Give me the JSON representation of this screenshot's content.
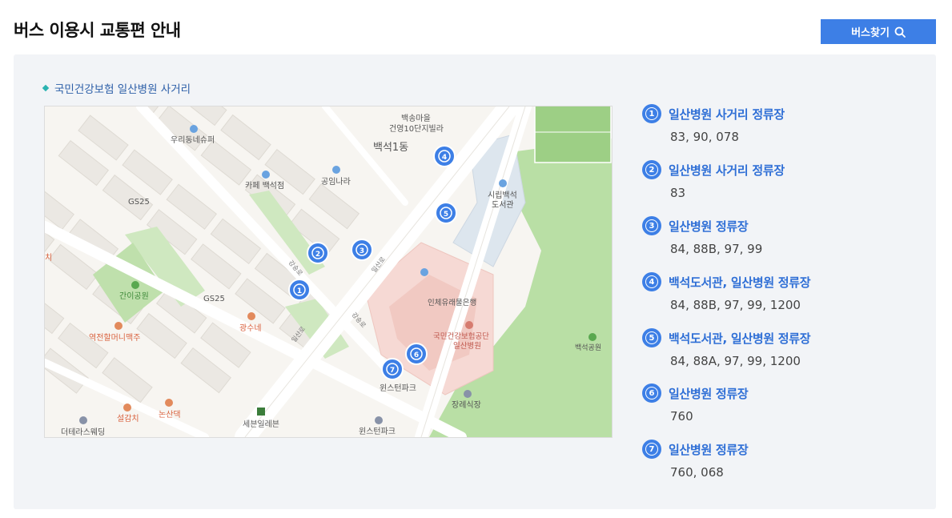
{
  "header": {
    "title": "버스 이용시 교통편 안내",
    "find_button_label": "버스찾기"
  },
  "location": {
    "name": "국민건강보험 일산병원 사거리"
  },
  "map": {
    "labels": {
      "baekma": "백송마을",
      "geonyoung": "건영10단지빌라",
      "baekseok1dong": "백석1동",
      "woori": "우리동네슈퍼",
      "cafe": "카페 백석점",
      "gongim": "공임나라",
      "library": "시립백석",
      "library2": "도서관",
      "gs25a": "GS25",
      "gs25b": "GS25",
      "ganipark": "간이공원",
      "bank": "인체유래물은행",
      "nhis1": "국민건강보험공단",
      "nhis2": "일산병원",
      "baekseokpark": "백석공원",
      "yeokjeon": "역전할머니맥주",
      "gwangsu": "광수네",
      "winston": "윈스턴파크",
      "winston2": "윈스턴파크",
      "funeral": "장례식장",
      "seolgam": "설감치",
      "nonsan": "논산댁",
      "seven": "세븐일레븐",
      "wedding": "더테라스웨딩",
      "chi": "치",
      "road1": "강송로",
      "road2": "일산로",
      "road3": "강송로",
      "road4": "일산로"
    },
    "markers": [
      "1",
      "2",
      "3",
      "4",
      "5",
      "6",
      "7"
    ]
  },
  "stops": [
    {
      "num": "1",
      "name": "일산병원 사거리 정류장",
      "routes": "83, 90, 078"
    },
    {
      "num": "2",
      "name": "일산병원 사거리 정류장",
      "routes": "83"
    },
    {
      "num": "3",
      "name": "일산병원 정류장",
      "routes": "84, 88B, 97, 99"
    },
    {
      "num": "4",
      "name": "백석도서관, 일산병원 정류장",
      "routes": "84, 88B, 97, 99, 1200"
    },
    {
      "num": "5",
      "name": "백석도서관, 일산병원 정류장",
      "routes": "84, 88A, 97, 99, 1200"
    },
    {
      "num": "6",
      "name": "일산병원 정류장",
      "routes": "760"
    },
    {
      "num": "7",
      "name": "일산병원 정류장",
      "routes": "760, 068"
    }
  ],
  "colors": {
    "accent": "#3d7fe6",
    "stop_name": "#2f6fd6",
    "panel_bg": "#f2f4f7",
    "location_text": "#2d5fa8",
    "park_green": "#b9dfa5",
    "hospital_pink": "#f6d9d4"
  }
}
